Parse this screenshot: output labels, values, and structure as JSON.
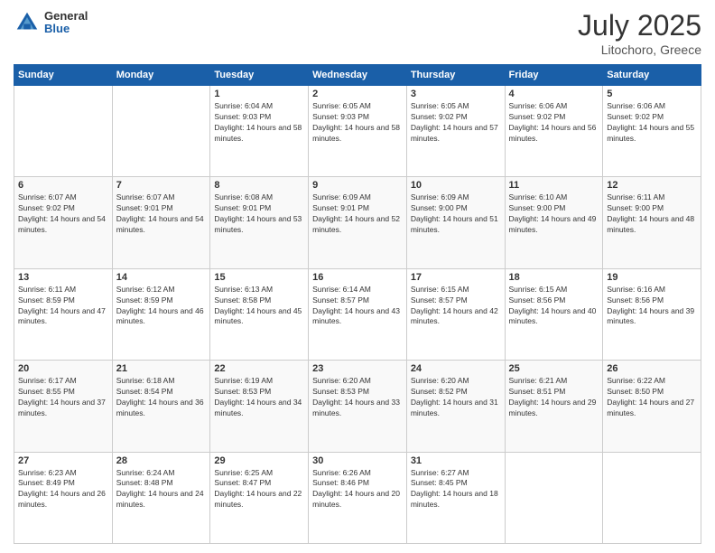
{
  "header": {
    "logo_general": "General",
    "logo_blue": "Blue",
    "month_title": "July 2025",
    "location": "Litochoro, Greece"
  },
  "calendar": {
    "days_of_week": [
      "Sunday",
      "Monday",
      "Tuesday",
      "Wednesday",
      "Thursday",
      "Friday",
      "Saturday"
    ],
    "weeks": [
      [
        {
          "day": "",
          "info": ""
        },
        {
          "day": "",
          "info": ""
        },
        {
          "day": "1",
          "info": "Sunrise: 6:04 AM\nSunset: 9:03 PM\nDaylight: 14 hours and 58 minutes."
        },
        {
          "day": "2",
          "info": "Sunrise: 6:05 AM\nSunset: 9:03 PM\nDaylight: 14 hours and 58 minutes."
        },
        {
          "day": "3",
          "info": "Sunrise: 6:05 AM\nSunset: 9:02 PM\nDaylight: 14 hours and 57 minutes."
        },
        {
          "day": "4",
          "info": "Sunrise: 6:06 AM\nSunset: 9:02 PM\nDaylight: 14 hours and 56 minutes."
        },
        {
          "day": "5",
          "info": "Sunrise: 6:06 AM\nSunset: 9:02 PM\nDaylight: 14 hours and 55 minutes."
        }
      ],
      [
        {
          "day": "6",
          "info": "Sunrise: 6:07 AM\nSunset: 9:02 PM\nDaylight: 14 hours and 54 minutes."
        },
        {
          "day": "7",
          "info": "Sunrise: 6:07 AM\nSunset: 9:01 PM\nDaylight: 14 hours and 54 minutes."
        },
        {
          "day": "8",
          "info": "Sunrise: 6:08 AM\nSunset: 9:01 PM\nDaylight: 14 hours and 53 minutes."
        },
        {
          "day": "9",
          "info": "Sunrise: 6:09 AM\nSunset: 9:01 PM\nDaylight: 14 hours and 52 minutes."
        },
        {
          "day": "10",
          "info": "Sunrise: 6:09 AM\nSunset: 9:00 PM\nDaylight: 14 hours and 51 minutes."
        },
        {
          "day": "11",
          "info": "Sunrise: 6:10 AM\nSunset: 9:00 PM\nDaylight: 14 hours and 49 minutes."
        },
        {
          "day": "12",
          "info": "Sunrise: 6:11 AM\nSunset: 9:00 PM\nDaylight: 14 hours and 48 minutes."
        }
      ],
      [
        {
          "day": "13",
          "info": "Sunrise: 6:11 AM\nSunset: 8:59 PM\nDaylight: 14 hours and 47 minutes."
        },
        {
          "day": "14",
          "info": "Sunrise: 6:12 AM\nSunset: 8:59 PM\nDaylight: 14 hours and 46 minutes."
        },
        {
          "day": "15",
          "info": "Sunrise: 6:13 AM\nSunset: 8:58 PM\nDaylight: 14 hours and 45 minutes."
        },
        {
          "day": "16",
          "info": "Sunrise: 6:14 AM\nSunset: 8:57 PM\nDaylight: 14 hours and 43 minutes."
        },
        {
          "day": "17",
          "info": "Sunrise: 6:15 AM\nSunset: 8:57 PM\nDaylight: 14 hours and 42 minutes."
        },
        {
          "day": "18",
          "info": "Sunrise: 6:15 AM\nSunset: 8:56 PM\nDaylight: 14 hours and 40 minutes."
        },
        {
          "day": "19",
          "info": "Sunrise: 6:16 AM\nSunset: 8:56 PM\nDaylight: 14 hours and 39 minutes."
        }
      ],
      [
        {
          "day": "20",
          "info": "Sunrise: 6:17 AM\nSunset: 8:55 PM\nDaylight: 14 hours and 37 minutes."
        },
        {
          "day": "21",
          "info": "Sunrise: 6:18 AM\nSunset: 8:54 PM\nDaylight: 14 hours and 36 minutes."
        },
        {
          "day": "22",
          "info": "Sunrise: 6:19 AM\nSunset: 8:53 PM\nDaylight: 14 hours and 34 minutes."
        },
        {
          "day": "23",
          "info": "Sunrise: 6:20 AM\nSunset: 8:53 PM\nDaylight: 14 hours and 33 minutes."
        },
        {
          "day": "24",
          "info": "Sunrise: 6:20 AM\nSunset: 8:52 PM\nDaylight: 14 hours and 31 minutes."
        },
        {
          "day": "25",
          "info": "Sunrise: 6:21 AM\nSunset: 8:51 PM\nDaylight: 14 hours and 29 minutes."
        },
        {
          "day": "26",
          "info": "Sunrise: 6:22 AM\nSunset: 8:50 PM\nDaylight: 14 hours and 27 minutes."
        }
      ],
      [
        {
          "day": "27",
          "info": "Sunrise: 6:23 AM\nSunset: 8:49 PM\nDaylight: 14 hours and 26 minutes."
        },
        {
          "day": "28",
          "info": "Sunrise: 6:24 AM\nSunset: 8:48 PM\nDaylight: 14 hours and 24 minutes."
        },
        {
          "day": "29",
          "info": "Sunrise: 6:25 AM\nSunset: 8:47 PM\nDaylight: 14 hours and 22 minutes."
        },
        {
          "day": "30",
          "info": "Sunrise: 6:26 AM\nSunset: 8:46 PM\nDaylight: 14 hours and 20 minutes."
        },
        {
          "day": "31",
          "info": "Sunrise: 6:27 AM\nSunset: 8:45 PM\nDaylight: 14 hours and 18 minutes."
        },
        {
          "day": "",
          "info": ""
        },
        {
          "day": "",
          "info": ""
        }
      ]
    ]
  }
}
